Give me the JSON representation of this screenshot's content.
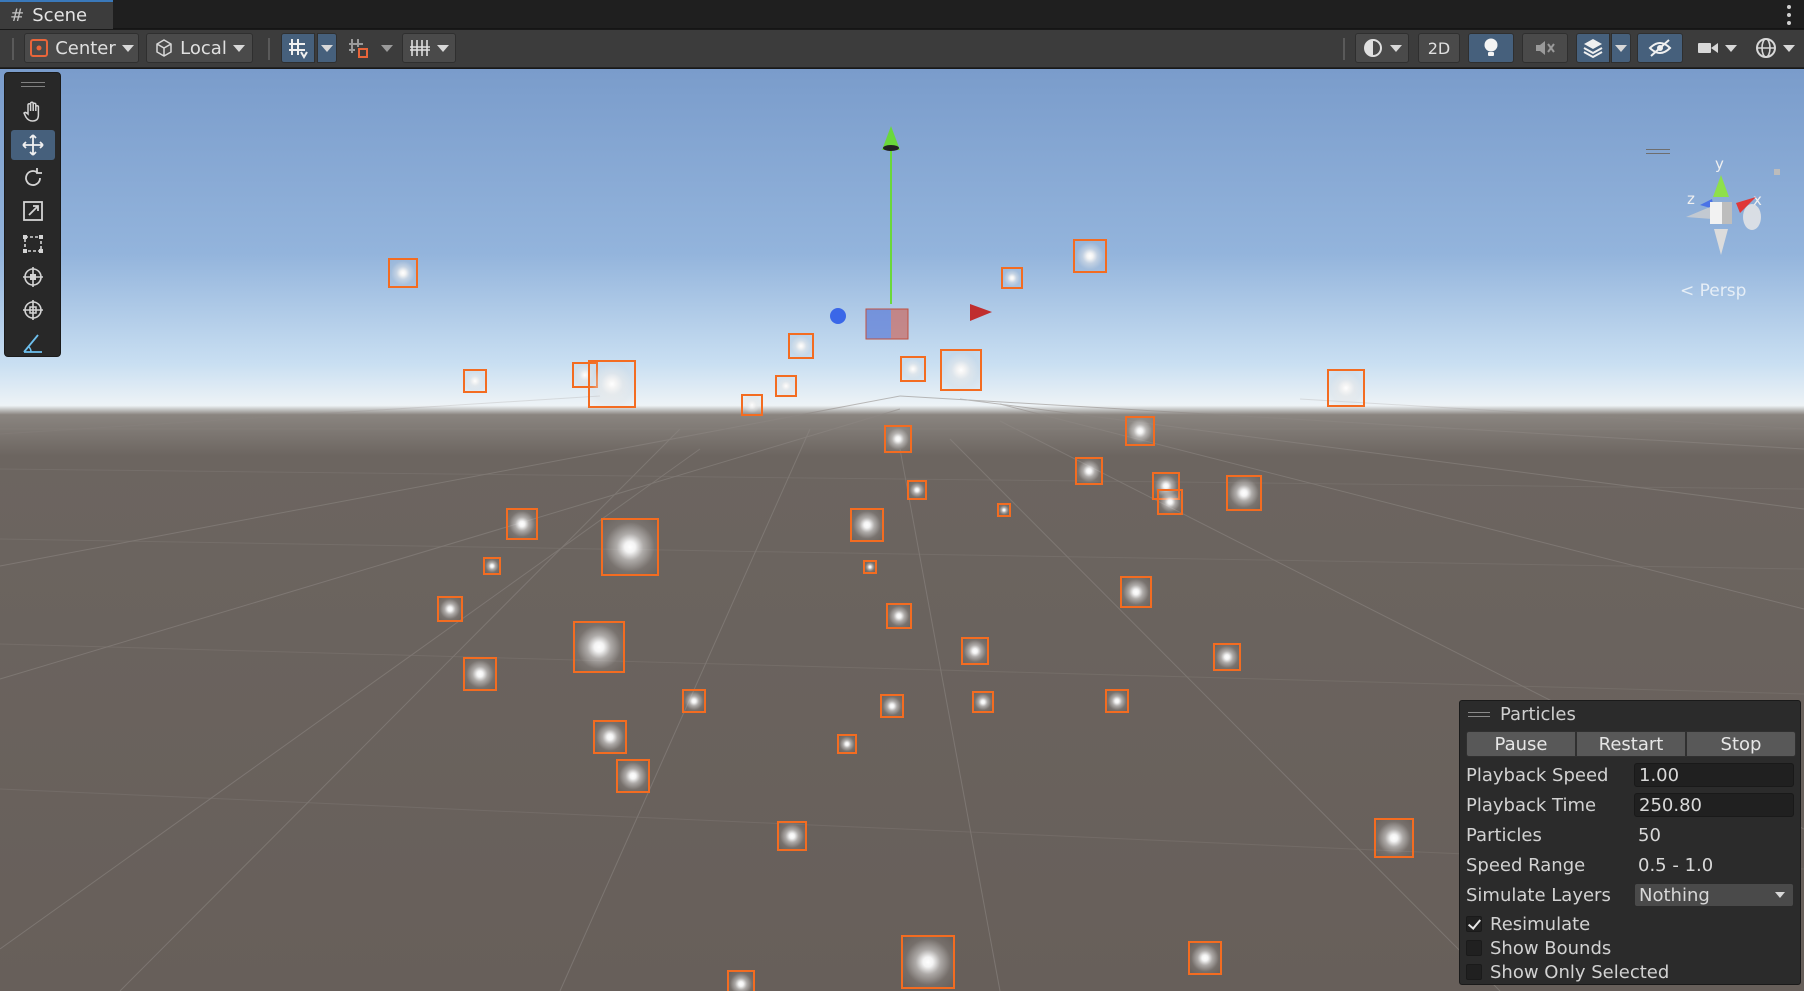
{
  "tab": {
    "title": "Scene",
    "icon": "hash-icon"
  },
  "toolbar": {
    "pivot_mode": "Center",
    "pivot_rotation": "Local",
    "two_d_label": "2D",
    "icons": [
      "pivot-icon",
      "local-space-icon",
      "grid-snap-icon",
      "increment-snap-icon",
      "grid-visibility-icon",
      "draw-mode-icon",
      "lighting-icon",
      "audio-mute-icon",
      "effects-icon",
      "hidden-objects-icon",
      "camera-icon",
      "gizmos-icon"
    ]
  },
  "tools": [
    "hand-tool",
    "move-tool",
    "rotate-tool",
    "scale-tool",
    "rect-tool",
    "transform-tool",
    "custom-editor-tool",
    "custom-tool"
  ],
  "tools_active": "move-tool",
  "gizmo": {
    "y_label": "y",
    "x_label": "x",
    "z_label": "z",
    "projection": "< Persp"
  },
  "particles_overlay": {
    "title": "Particles",
    "buttons": {
      "pause": "Pause",
      "restart": "Restart",
      "stop": "Stop"
    },
    "playback_speed_label": "Playback Speed",
    "playback_speed": "1.00",
    "playback_time_label": "Playback Time",
    "playback_time": "250.80",
    "particles_label": "Particles",
    "particles": "50",
    "speed_range_label": "Speed Range",
    "speed_range": "0.5 - 1.0",
    "simulate_layers_label": "Simulate Layers",
    "simulate_layers": "Nothing",
    "resimulate_label": "Resimulate",
    "resimulate": true,
    "show_bounds_label": "Show Bounds",
    "show_bounds": false,
    "show_only_selected_label": "Show Only Selected",
    "show_only_selected": false
  },
  "colors": {
    "selection": "#f36c21",
    "active_tool": "#46607c",
    "x_axis": "#d23a3a",
    "y_axis": "#6ad83a",
    "z_axis": "#3a67e8"
  }
}
